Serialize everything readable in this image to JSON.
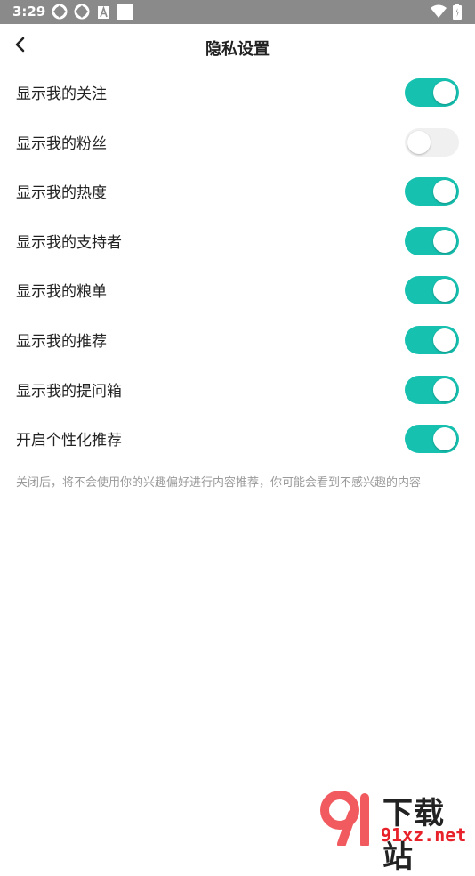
{
  "status": {
    "time": "3:29"
  },
  "header": {
    "title": "隐私设置"
  },
  "settings": [
    {
      "label": "显示我的关注",
      "enabled": true
    },
    {
      "label": "显示我的粉丝",
      "enabled": false
    },
    {
      "label": "显示我的热度",
      "enabled": true
    },
    {
      "label": "显示我的支持者",
      "enabled": true
    },
    {
      "label": "显示我的粮单",
      "enabled": true
    },
    {
      "label": "显示我的推荐",
      "enabled": true
    },
    {
      "label": "显示我的提问箱",
      "enabled": true
    },
    {
      "label": "开启个性化推荐",
      "enabled": true
    }
  ],
  "note": "关闭后，将不会使用你的兴趣偏好进行内容推荐，你可能会看到不感兴趣的内容",
  "watermark": {
    "title": "下载站",
    "site": "91xz.net"
  },
  "colors": {
    "accent": "#16c1b0",
    "toggle_off": "#f0f0f0"
  }
}
